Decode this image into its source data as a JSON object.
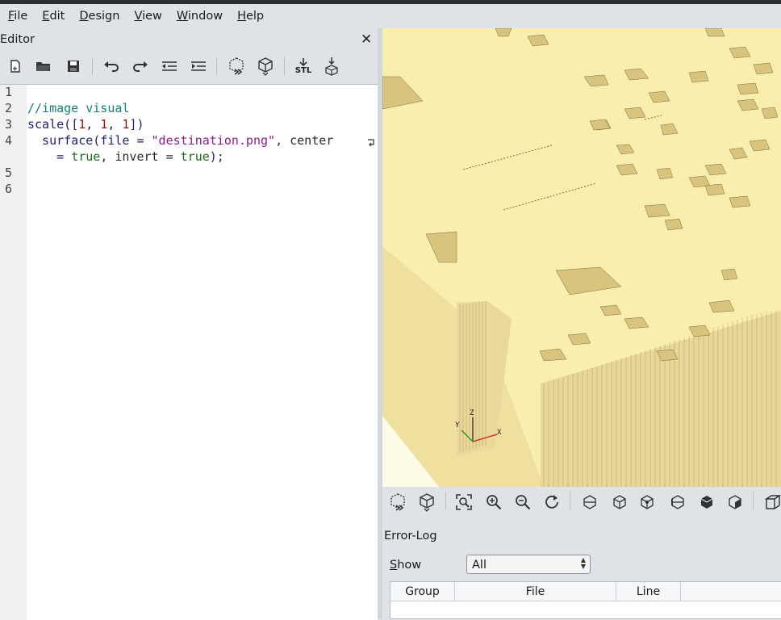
{
  "menu": [
    {
      "key": "F",
      "rest": "ile"
    },
    {
      "key": "E",
      "rest": "dit"
    },
    {
      "key": "D",
      "rest": "esign"
    },
    {
      "key": "V",
      "rest": "iew"
    },
    {
      "key": "W",
      "rest": "indow"
    },
    {
      "key": "H",
      "rest": "elp"
    }
  ],
  "editor": {
    "title": "Editor",
    "close_glyph": "✕",
    "toolbar_icons": [
      "new-file-icon",
      "open-file-icon",
      "save-icon",
      "undo-icon",
      "redo-icon",
      "unindent-icon",
      "indent-icon",
      "preview-icon",
      "render-icon",
      "export-stl-icon",
      "send-to-print-icon"
    ],
    "stl_label": "STL",
    "line_numbers": [
      "1",
      "2",
      "3",
      "4",
      "5",
      "6"
    ],
    "code": {
      "l2": "//image visual",
      "l3_fn": "scale(",
      "l3_a": "[",
      "l3_n1": "1",
      "l3_c1": ", ",
      "l3_n2": "1",
      "l3_c2": ", ",
      "l3_n3": "1",
      "l3_b": "])",
      "l4_fn": "  surface(file = ",
      "l4_str": "\"destination.png\"",
      "l4_tail": ", center",
      "l4w_eq": "    = ",
      "l4w_true1": "true",
      "l4w_mid": ", invert = ",
      "l4w_true2": "true",
      "l4w_end": ");"
    }
  },
  "viewport": {
    "axis_labels": {
      "z": "Z",
      "x": "X",
      "y": "Y"
    },
    "model_color": "#f9eeae"
  },
  "view_toolbar_icons": [
    "preview-icon",
    "render-icon",
    "view-all-icon",
    "zoom-in-icon",
    "zoom-out-icon",
    "reset-view-icon",
    "view-right-icon",
    "view-top-icon",
    "view-bottom-icon",
    "view-left-icon",
    "view-front-icon",
    "view-back-icon",
    "perspective-icon"
  ],
  "errorlog": {
    "title": "Error-Log",
    "show_key": "S",
    "show_rest": "how",
    "show_value": "All",
    "columns": [
      "Group",
      "File",
      "Line"
    ]
  }
}
